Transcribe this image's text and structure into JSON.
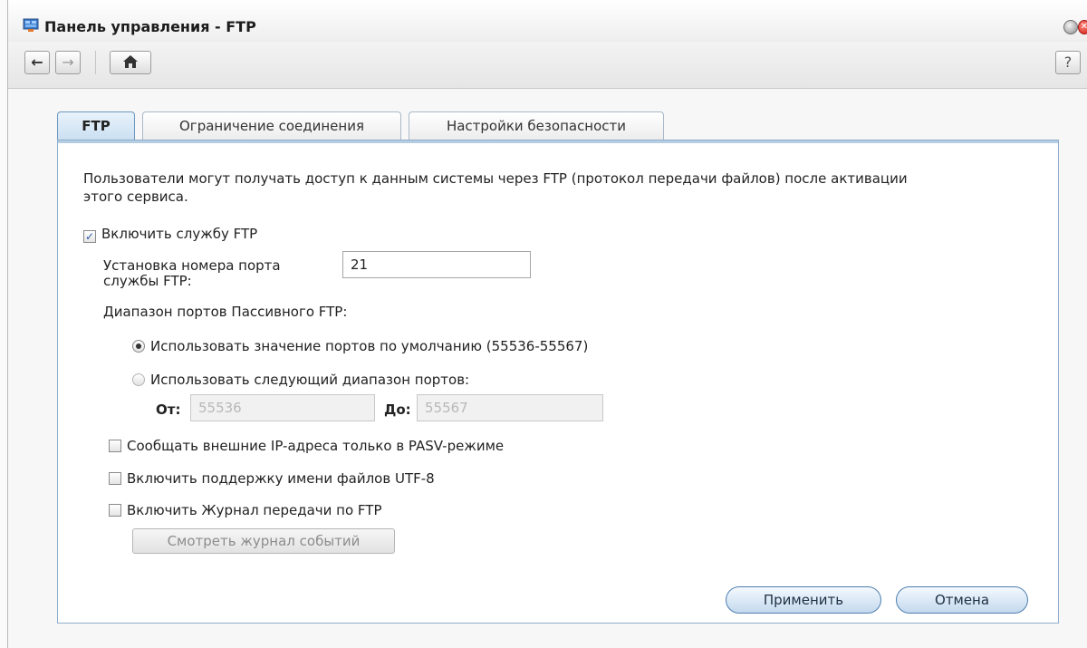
{
  "window": {
    "title": "Панель управления - FTP",
    "close_glyph": "✕"
  },
  "toolbar": {
    "back_icon": "←",
    "forward_icon": "→",
    "home_icon": "⌂",
    "help_icon": "?"
  },
  "tabs": [
    {
      "label": "FTP",
      "active": true
    },
    {
      "label": "Ограничение соединения",
      "active": false
    },
    {
      "label": "Настройки безопасности",
      "active": false
    }
  ],
  "ftp": {
    "description_line1": "Пользователи могут получать доступ к данным системы через FTP (протокол передачи файлов) после активации",
    "description_line2": "этого сервиса.",
    "enable_ftp": {
      "label": "Включить службу FTP",
      "checked": true,
      "glyph": "✓"
    },
    "port_label_line1": "Установка номера порта",
    "port_label_line2": "службы FTP:",
    "port_value": "21",
    "passive_range_label": "Диапазон портов Пассивного FTP:",
    "radio_default": {
      "label": "Использовать значение портов по умолчанию (55536-55567)",
      "selected": true
    },
    "radio_custom": {
      "label": "Использовать следующий диапазон портов:",
      "selected": false
    },
    "from_label": "От:",
    "from_value": "55536",
    "to_label": "До:",
    "to_value": "55567",
    "pasv_only": {
      "label": "Сообщать внешние IP-адреса только в PASV-режиме",
      "checked": false
    },
    "utf8": {
      "label": "Включить поддержку имени файлов UTF-8",
      "checked": false
    },
    "transfer_log": {
      "label": "Включить Журнал передачи по FTP",
      "checked": false
    },
    "view_log_button": "Смотреть журнал событий"
  },
  "actions": {
    "apply": "Применить",
    "cancel": "Отмена"
  },
  "colors": {
    "accent": "#4f7fb0",
    "panel_border": "#8eadc9"
  }
}
